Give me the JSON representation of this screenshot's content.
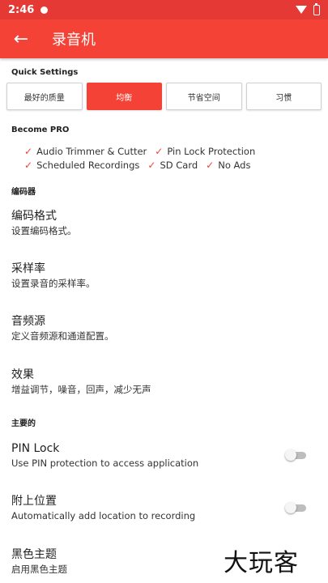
{
  "status_bar": {
    "time": "2:46"
  },
  "app_bar": {
    "title": "录音机"
  },
  "quick_settings": {
    "header": "Quick Settings",
    "options": [
      "最好的质量",
      "均衡",
      "节省空间",
      "习惯"
    ],
    "selected": "均衡"
  },
  "become_pro": {
    "header": "Become PRO",
    "features": [
      "Audio Trimmer & Cutter",
      "Pin Lock Protection",
      "Scheduled Recordings",
      "SD Card",
      "No Ads"
    ]
  },
  "encoder": {
    "header": "编码器",
    "items": [
      {
        "title": "编码格式",
        "summary": "设置编码格式。"
      },
      {
        "title": "采样率",
        "summary": "设置录音的采样率。"
      },
      {
        "title": "音频源",
        "summary": "定义音频源和通道配置。"
      },
      {
        "title": "效果",
        "summary": "增益调节，噪音，回声，减少无声"
      }
    ]
  },
  "main": {
    "header": "主要的",
    "items": [
      {
        "title": "PIN Lock",
        "summary": "Use PIN protection to access application",
        "enabled": false
      },
      {
        "title": "附上位置",
        "summary": "Automatically add location to recording",
        "enabled": false
      },
      {
        "title": "黑色主题",
        "summary": "启用黑色主题"
      }
    ]
  },
  "watermark": "大玩客",
  "colors": {
    "accent": "#f44336",
    "status_bar": "#e53935"
  }
}
